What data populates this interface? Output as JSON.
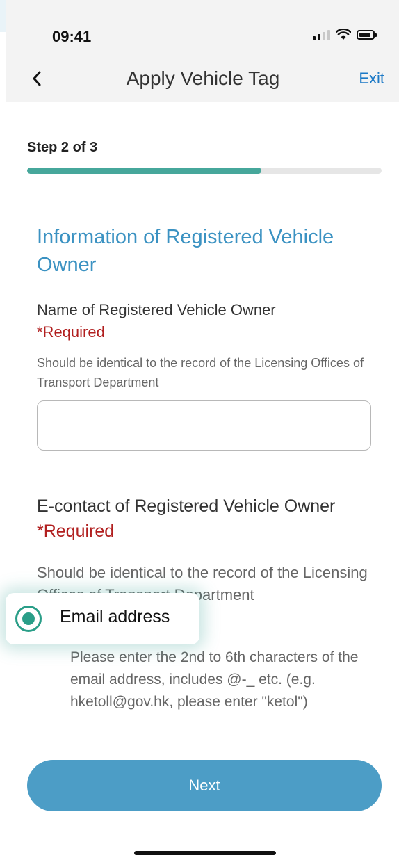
{
  "status_bar": {
    "time": "09:41",
    "signal_icon": "signal-icon",
    "wifi_icon": "wifi-icon",
    "battery_icon": "battery-icon"
  },
  "header": {
    "title": "Apply Vehicle Tag",
    "back_icon": "chevron-left-icon",
    "exit_label": "Exit"
  },
  "progress": {
    "step_label": "Step 2 of 3",
    "percent": 66,
    "fill_color": "#46a79b"
  },
  "section": {
    "title": "Information of Registered Vehicle Owner"
  },
  "fields": {
    "owner_name": {
      "label": "Name of Registered Vehicle Owner",
      "required": "*Required",
      "help": "Should be identical to the record of the Licensing Offices of Transport Department",
      "value": "",
      "placeholder": ""
    },
    "e_contact": {
      "label": "E-contact of Registered Vehicle Owner",
      "required": "*Required",
      "help": "Should be identical to the record of the Licensing Offices of Transport Department",
      "selected_option": "Email address",
      "hint": "Please enter the 2nd to 6th characters of the email address, includes @-_ etc. (e.g. hketoll@gov.hk, please enter \"ketol\")"
    }
  },
  "actions": {
    "next_label": "Next"
  },
  "colors": {
    "accent_blue": "#3b92c2",
    "button_blue": "#4c9dc6",
    "required_red": "#b11f1f",
    "radio_green": "#2a9e88"
  }
}
